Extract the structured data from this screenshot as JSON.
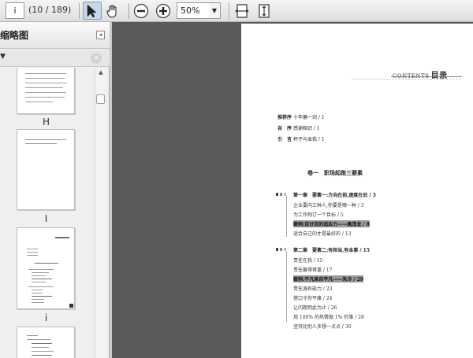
{
  "toolbar": {
    "page_input": "i",
    "page_count": "(10 / 189)",
    "zoom_value": "50%",
    "zoom_dropdown_icon": "chevron-down-icon",
    "tools": [
      "select-tool-icon",
      "hand-tool-icon",
      "zoom-out-icon",
      "zoom-in-icon",
      "fit-width-icon",
      "fit-page-icon"
    ]
  },
  "panel": {
    "title": "缩略图",
    "collapse_icon": "collapse-panel-icon",
    "close_icon": "close-icon",
    "thumbnails": [
      {
        "label": "H"
      },
      {
        "label": "I"
      },
      {
        "label": "i"
      },
      {
        "label": ""
      }
    ]
  },
  "document": {
    "contents_title": "CONTENTS",
    "contents_title_cn": "目录",
    "front_matter": [
      {
        "key": "推荐序",
        "text": "十年磨一剑 / 1"
      },
      {
        "key": "自　序",
        "text": "感谢相识 / 1"
      },
      {
        "key": "引　言",
        "text": "杯子与本我 / 1"
      }
    ],
    "volume_title": "卷一　职场起跑三要素",
    "chapter1": {
      "title": "第一章　要素一:方向在前,速度在后 / 3",
      "items": [
        {
          "text": "企业要向三种人,你要是哪一种 / 3",
          "highlight": false
        },
        {
          "text": "为工作制订一个目标 / 5",
          "highlight": false
        },
        {
          "text": "案例:百分百的适应力——高茂龙 / 8",
          "highlight": true
        },
        {
          "text": "适合自己的才是最好的 / 13",
          "highlight": false
        }
      ]
    },
    "chapter2": {
      "title": "第二章　要素二:有担当,有本事 / 15",
      "items": [
        {
          "text": "责任在我 / 15",
          "highlight": false
        },
        {
          "text": "责任赢得尊重 / 17",
          "highlight": false
        },
        {
          "text": "案例:不凡来自平凡——朱冷 / 29",
          "highlight": true
        },
        {
          "text": "责任源有能力 / 23",
          "highlight": false
        },
        {
          "text": "借口令你平庸 / 24",
          "highlight": false
        },
        {
          "text": "让问题到此为止 / 26",
          "highlight": false
        },
        {
          "text": "用 100% 的热情做 1% 的事 / 28",
          "highlight": false
        },
        {
          "text": "坚持比别人多想一点点 / 30",
          "highlight": false
        }
      ]
    }
  }
}
